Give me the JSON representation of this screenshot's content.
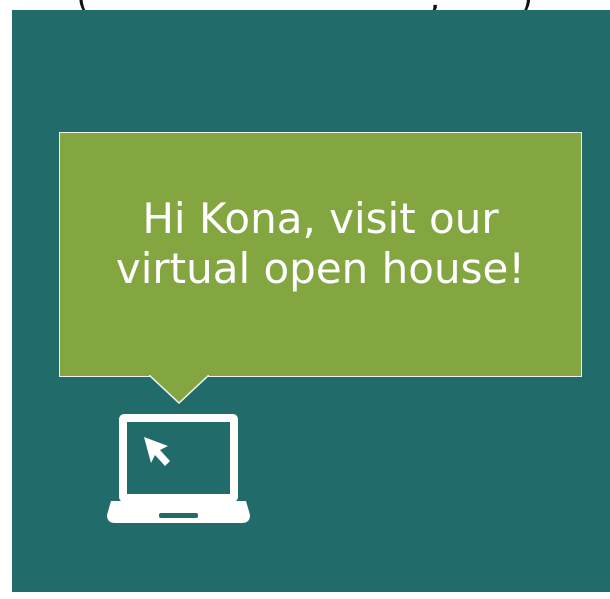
{
  "header": {
    "partial_text": "(                              ,       )"
  },
  "callout": {
    "message_line1": "Hi Kona, visit our",
    "message_line2": "virtual open house!"
  },
  "colors": {
    "panel_background": "#216b6b",
    "bubble_background": "#84a641",
    "bubble_border": "#f2f2f2",
    "text": "#ffffff"
  },
  "icons": {
    "laptop": "laptop-icon",
    "cursor": "cursor-arrow-icon"
  }
}
